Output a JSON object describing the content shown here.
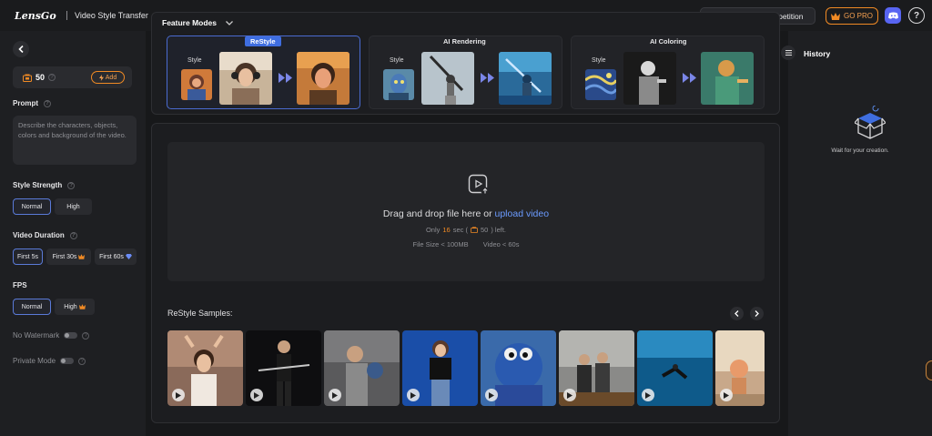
{
  "header": {
    "logo": "LensGo",
    "app_title": "Video Style Transfer",
    "competition_label": "Style Fast Competition",
    "go_pro_label": "GO PRO",
    "help_label": "?"
  },
  "left_panel": {
    "credits": "50",
    "add_label": "Add",
    "prompt_label": "Prompt",
    "prompt_placeholder": "Describe the characters, objects, colors and background of the video.",
    "style_strength_label": "Style Strength",
    "style_strength_options": [
      "Normal",
      "High"
    ],
    "style_strength_selected": "Normal",
    "video_duration_label": "Video Duration",
    "video_duration_options": [
      "First 5s",
      "First 30s",
      "First 60s"
    ],
    "video_duration_selected": "First 5s",
    "fps_label": "FPS",
    "fps_options": [
      "Normal",
      "High"
    ],
    "fps_selected": "Normal",
    "no_watermark_label": "No Watermark",
    "private_mode_label": "Private Mode"
  },
  "feature_modes": {
    "title": "Feature Modes",
    "modes": [
      {
        "label": "ReStyle",
        "style_tag": "Style",
        "active": true
      },
      {
        "label": "AI Rendering",
        "style_tag": "Style",
        "active": false
      },
      {
        "label": "AI Coloring",
        "style_tag": "Style",
        "active": false
      }
    ]
  },
  "upload": {
    "drop_text": "Drag and drop file here or",
    "upload_link": "upload video",
    "only_prefix": "Only",
    "seconds_left": "16",
    "sec_label": "sec (",
    "credits_left": "50",
    "left_suffix": ") left.",
    "file_size": "File Size < 100MB",
    "video_limit": "Video < 60s"
  },
  "samples": {
    "title": "ReStyle Samples:",
    "items": [
      "Ballet dancer",
      "Samurai",
      "Boxer",
      "Woman in black",
      "Blue monster",
      "Group photo",
      "Diver",
      "Toys"
    ]
  },
  "history": {
    "title": "History",
    "empty_text": "Wait for your creation."
  },
  "colors": {
    "accent_blue": "#3f6ee0",
    "accent_orange": "#f08a24",
    "link_blue": "#6b9bff",
    "discord": "#5865f2"
  }
}
